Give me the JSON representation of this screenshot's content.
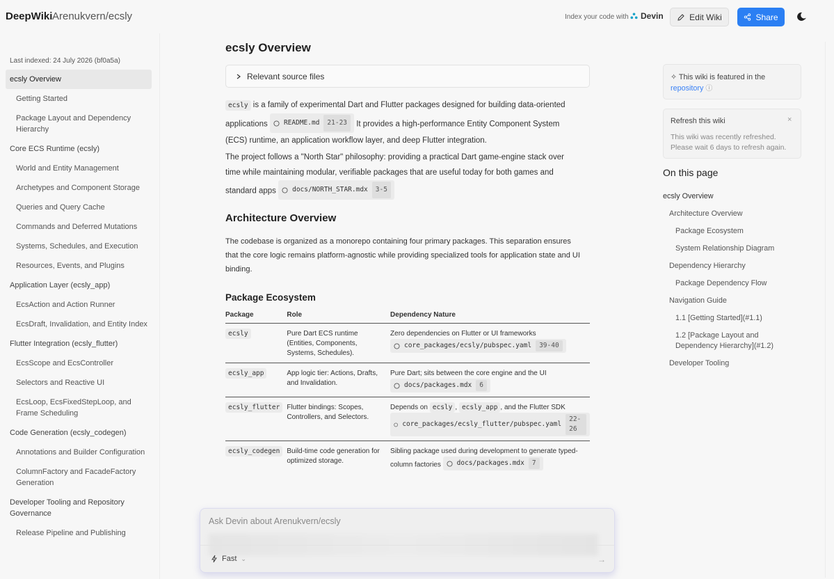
{
  "header": {
    "brand": "DeepWiki",
    "repo": "Arenukvern/ecsly",
    "index_text": "Index your code with",
    "devin_label": "Devin",
    "edit_label": "Edit Wiki",
    "share_label": "Share"
  },
  "sidebar": {
    "last_indexed": "Last indexed: 24 July 2026 (bf0a5a)",
    "items": [
      {
        "label": "ecsly Overview",
        "level": 0,
        "active": true
      },
      {
        "label": "Getting Started",
        "level": 1
      },
      {
        "label": "Package Layout and Dependency Hierarchy",
        "level": 1
      },
      {
        "label": "Core ECS Runtime (ecsly)",
        "level": 0
      },
      {
        "label": "World and Entity Management",
        "level": 1
      },
      {
        "label": "Archetypes and Component Storage",
        "level": 1
      },
      {
        "label": "Queries and Query Cache",
        "level": 1
      },
      {
        "label": "Commands and Deferred Mutations",
        "level": 1
      },
      {
        "label": "Systems, Schedules, and Execution",
        "level": 1
      },
      {
        "label": "Resources, Events, and Plugins",
        "level": 1
      },
      {
        "label": "Application Layer (ecsly_app)",
        "level": 0
      },
      {
        "label": "EcsAction and Action Runner",
        "level": 1
      },
      {
        "label": "EcsDraft, Invalidation, and Entity Index",
        "level": 1
      },
      {
        "label": "Flutter Integration (ecsly_flutter)",
        "level": 0
      },
      {
        "label": "EcsScope and EcsController",
        "level": 1
      },
      {
        "label": "Selectors and Reactive UI",
        "level": 1
      },
      {
        "label": "EcsLoop, EcsFixedStepLoop, and Frame Scheduling",
        "level": 1
      },
      {
        "label": "Code Generation (ecsly_codegen)",
        "level": 0
      },
      {
        "label": "Annotations and Builder Configuration",
        "level": 1
      },
      {
        "label": "ColumnFactory and FacadeFactory Generation",
        "level": 1
      },
      {
        "label": "Developer Tooling and Repository Governance",
        "level": 0
      },
      {
        "label": "Release Pipeline and Publishing",
        "level": 1
      }
    ]
  },
  "main": {
    "title": "ecsly Overview",
    "relevant_sources": "Relevant source files",
    "p1": {
      "code": "ecsly",
      "text_a": " is a family of experimental Dart and Flutter packages designed for building data-oriented applications ",
      "chip_file": "README.md",
      "chip_lines": "21-23",
      "text_b": " It provides a high-performance Entity Component System (ECS) runtime, an application workflow layer, and deep Flutter integration."
    },
    "p2": {
      "text": "The project follows a \"North Star\" philosophy: providing a practical Dart game-engine stack over time while maintaining modular, verifiable packages that are useful today for both games and standard apps ",
      "chip_file": "docs/NORTH_STAR.mdx",
      "chip_lines": "3-5"
    },
    "arch_heading": "Architecture Overview",
    "arch_text": "The codebase is organized as a monorepo containing four primary packages. This separation ensures that the core logic remains platform-agnostic while providing specialized tools for application state and UI binding.",
    "pkg_heading": "Package Ecosystem",
    "table": {
      "headers": [
        "Package",
        "Role",
        "Dependency Nature"
      ],
      "rows": [
        {
          "pkg": "ecsly",
          "role": "Pure Dart ECS runtime (Entities, Components, Systems, Schedules).",
          "dep": "Zero dependencies on Flutter or UI frameworks",
          "chip_file": "core_packages/ecsly/pubspec.yaml",
          "chip_lines": "39-40"
        },
        {
          "pkg": "ecsly_app",
          "role": "App logic tier: Actions, Drafts, and Invalidation.",
          "dep": "Pure Dart; sits between the core engine and the UI",
          "chip_file": "docs/packages.mdx",
          "chip_lines": "6"
        },
        {
          "pkg": "ecsly_flutter",
          "role": "Flutter bindings: Scopes, Controllers, and Selectors.",
          "dep_a": "Depends on ",
          "dep_code1": "ecsly",
          "dep_b": ", ",
          "dep_code2": "ecsly_app",
          "dep_c": ", and the Flutter SDK",
          "chip_file": "core_packages/ecsly_flutter/pubspec.yaml",
          "chip_lines": "22-26"
        },
        {
          "pkg": "ecsly_codegen",
          "role": "Build-time code generation for optimized storage.",
          "dep": "Sibling package used during development to generate typed-column factories ",
          "chip_file": "docs/packages.mdx",
          "chip_lines": "7"
        }
      ]
    }
  },
  "right": {
    "featured_text": "This wiki is featured in the",
    "featured_link": "repository",
    "refresh_title": "Refresh this wiki",
    "refresh_text": "This wiki was recently refreshed. Please wait 6 days to refresh again.",
    "toc_heading": "On this page",
    "toc": [
      {
        "label": "ecsly Overview",
        "level": 0
      },
      {
        "label": "Architecture Overview",
        "level": 1
      },
      {
        "label": "Package Ecosystem",
        "level": 2
      },
      {
        "label": "System Relationship Diagram",
        "level": 2
      },
      {
        "label": "Dependency Hierarchy",
        "level": 1
      },
      {
        "label": "Package Dependency Flow",
        "level": 2
      },
      {
        "label": "Navigation Guide",
        "level": 1
      },
      {
        "label": "1.1 [Getting Started](#1.1)",
        "level": 2
      },
      {
        "label": "1.2 [Package Layout and Dependency Hierarchy](#1.2)",
        "level": 2
      },
      {
        "label": "Developer Tooling",
        "level": 1
      }
    ]
  },
  "ask": {
    "placeholder": "Ask Devin about Arenukvern/ecsly",
    "mode": "Fast"
  },
  "colors": {
    "accent": "#2b7ff3",
    "link": "#3b82f6"
  }
}
